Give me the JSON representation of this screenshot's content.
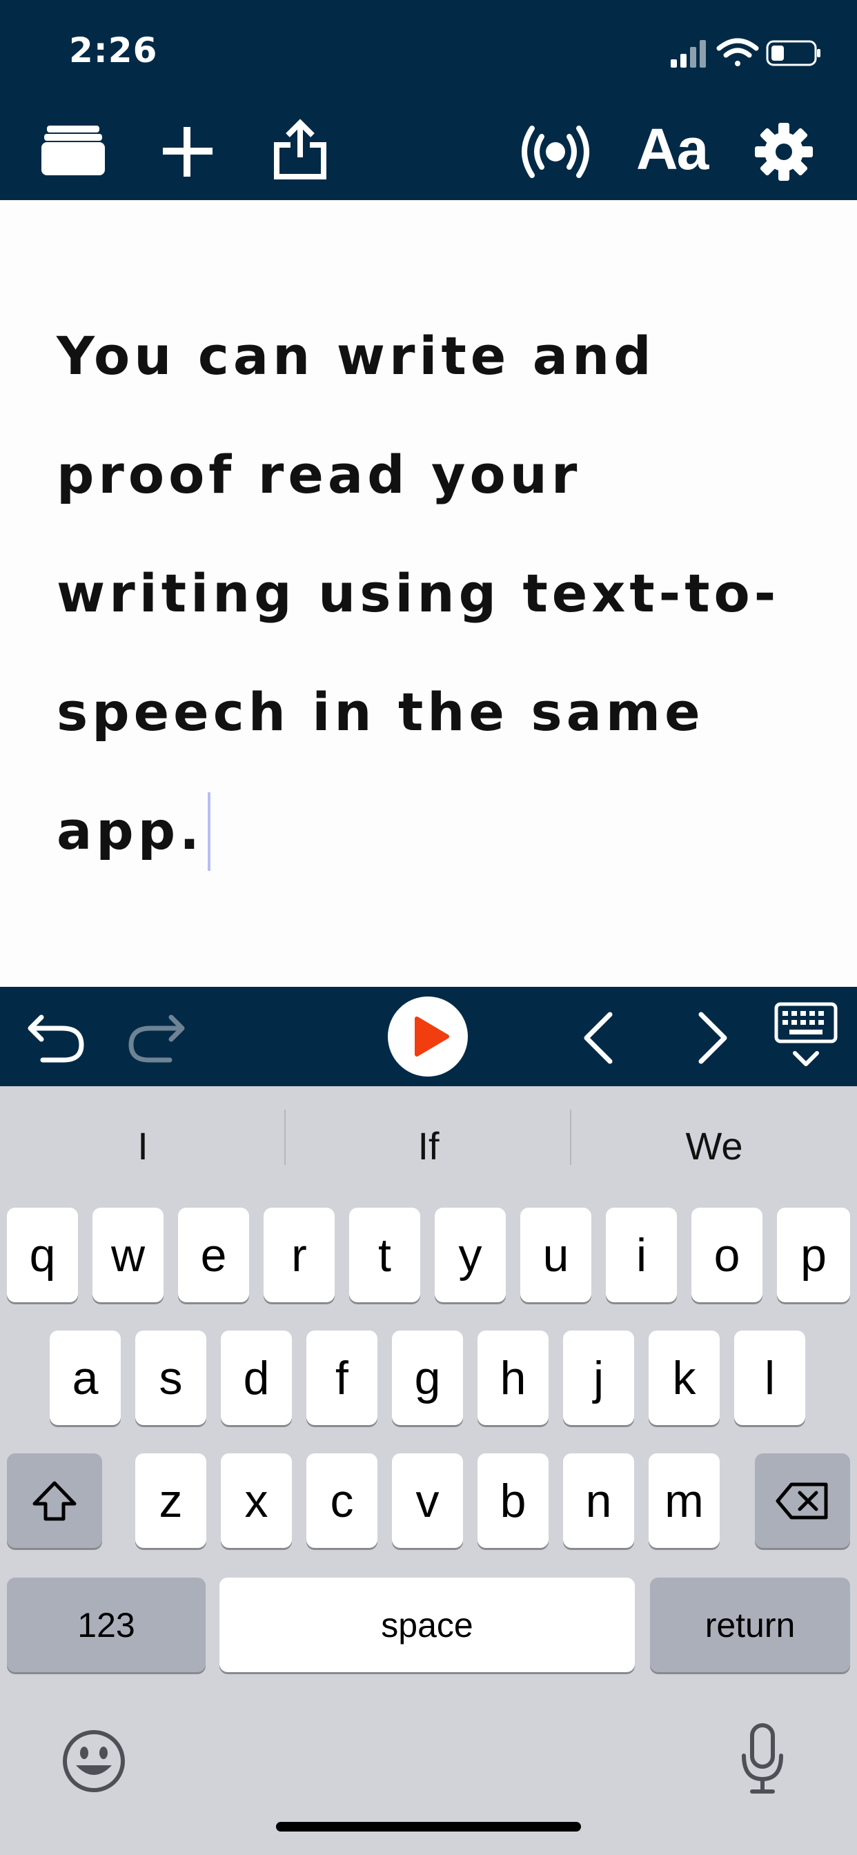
{
  "status": {
    "time": "2:26"
  },
  "toolbar": {
    "icons": [
      "folder-icon",
      "plus-icon",
      "share-icon",
      "broadcast-icon",
      "font-icon",
      "gear-icon"
    ],
    "font_label": "Aa"
  },
  "editor": {
    "text": "You can write and proof read your writing using text-to-speech in the same app."
  },
  "accessory": {
    "icons": [
      "undo-icon",
      "redo-icon",
      "play-icon",
      "chevron-left-icon",
      "chevron-right-icon",
      "keyboard-dismiss-icon"
    ],
    "colors": {
      "bar": "#022a46",
      "play": "#f23d0f"
    }
  },
  "keyboard": {
    "suggestions": [
      "I",
      "If",
      "We"
    ],
    "row1": [
      "q",
      "w",
      "e",
      "r",
      "t",
      "y",
      "u",
      "i",
      "o",
      "p"
    ],
    "row2": [
      "a",
      "s",
      "d",
      "f",
      "g",
      "h",
      "j",
      "k",
      "l"
    ],
    "row3": [
      "z",
      "x",
      "c",
      "v",
      "b",
      "n",
      "m"
    ],
    "numbers_label": "123",
    "space_label": "space",
    "return_label": "return"
  }
}
